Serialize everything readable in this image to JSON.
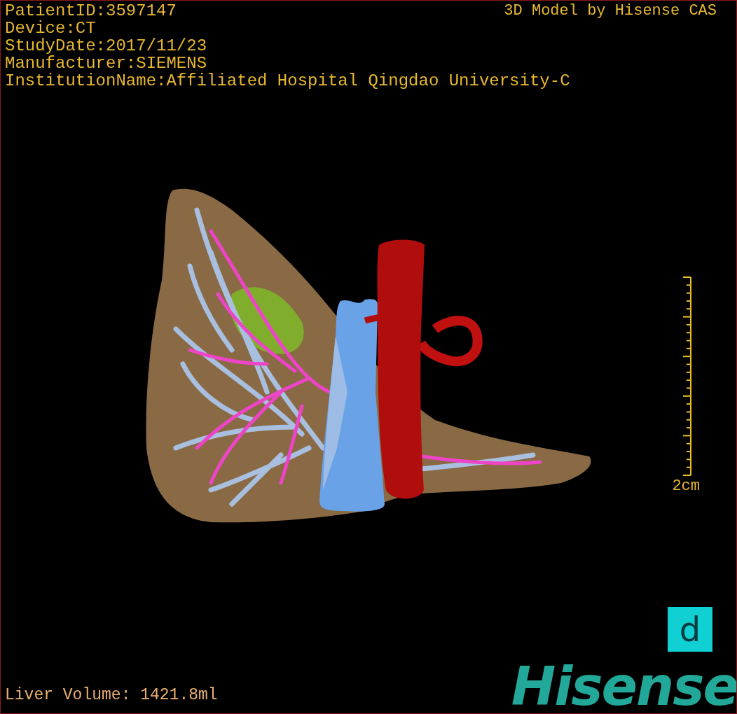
{
  "info_lines": [
    "PatientID:3597147",
    "Device:CT",
    "StudyDate:2017/11/23",
    "Manufacturer:SIEMENS",
    "InstitutionName:Affiliated Hospital Qingdao University-C"
  ],
  "title": "3D Model by Hisense CAS",
  "scale_bar": {
    "label": "2cm"
  },
  "liver_volume": "Liver Volume: 1421.8ml",
  "view_button": "d",
  "logo": "Hisense"
}
